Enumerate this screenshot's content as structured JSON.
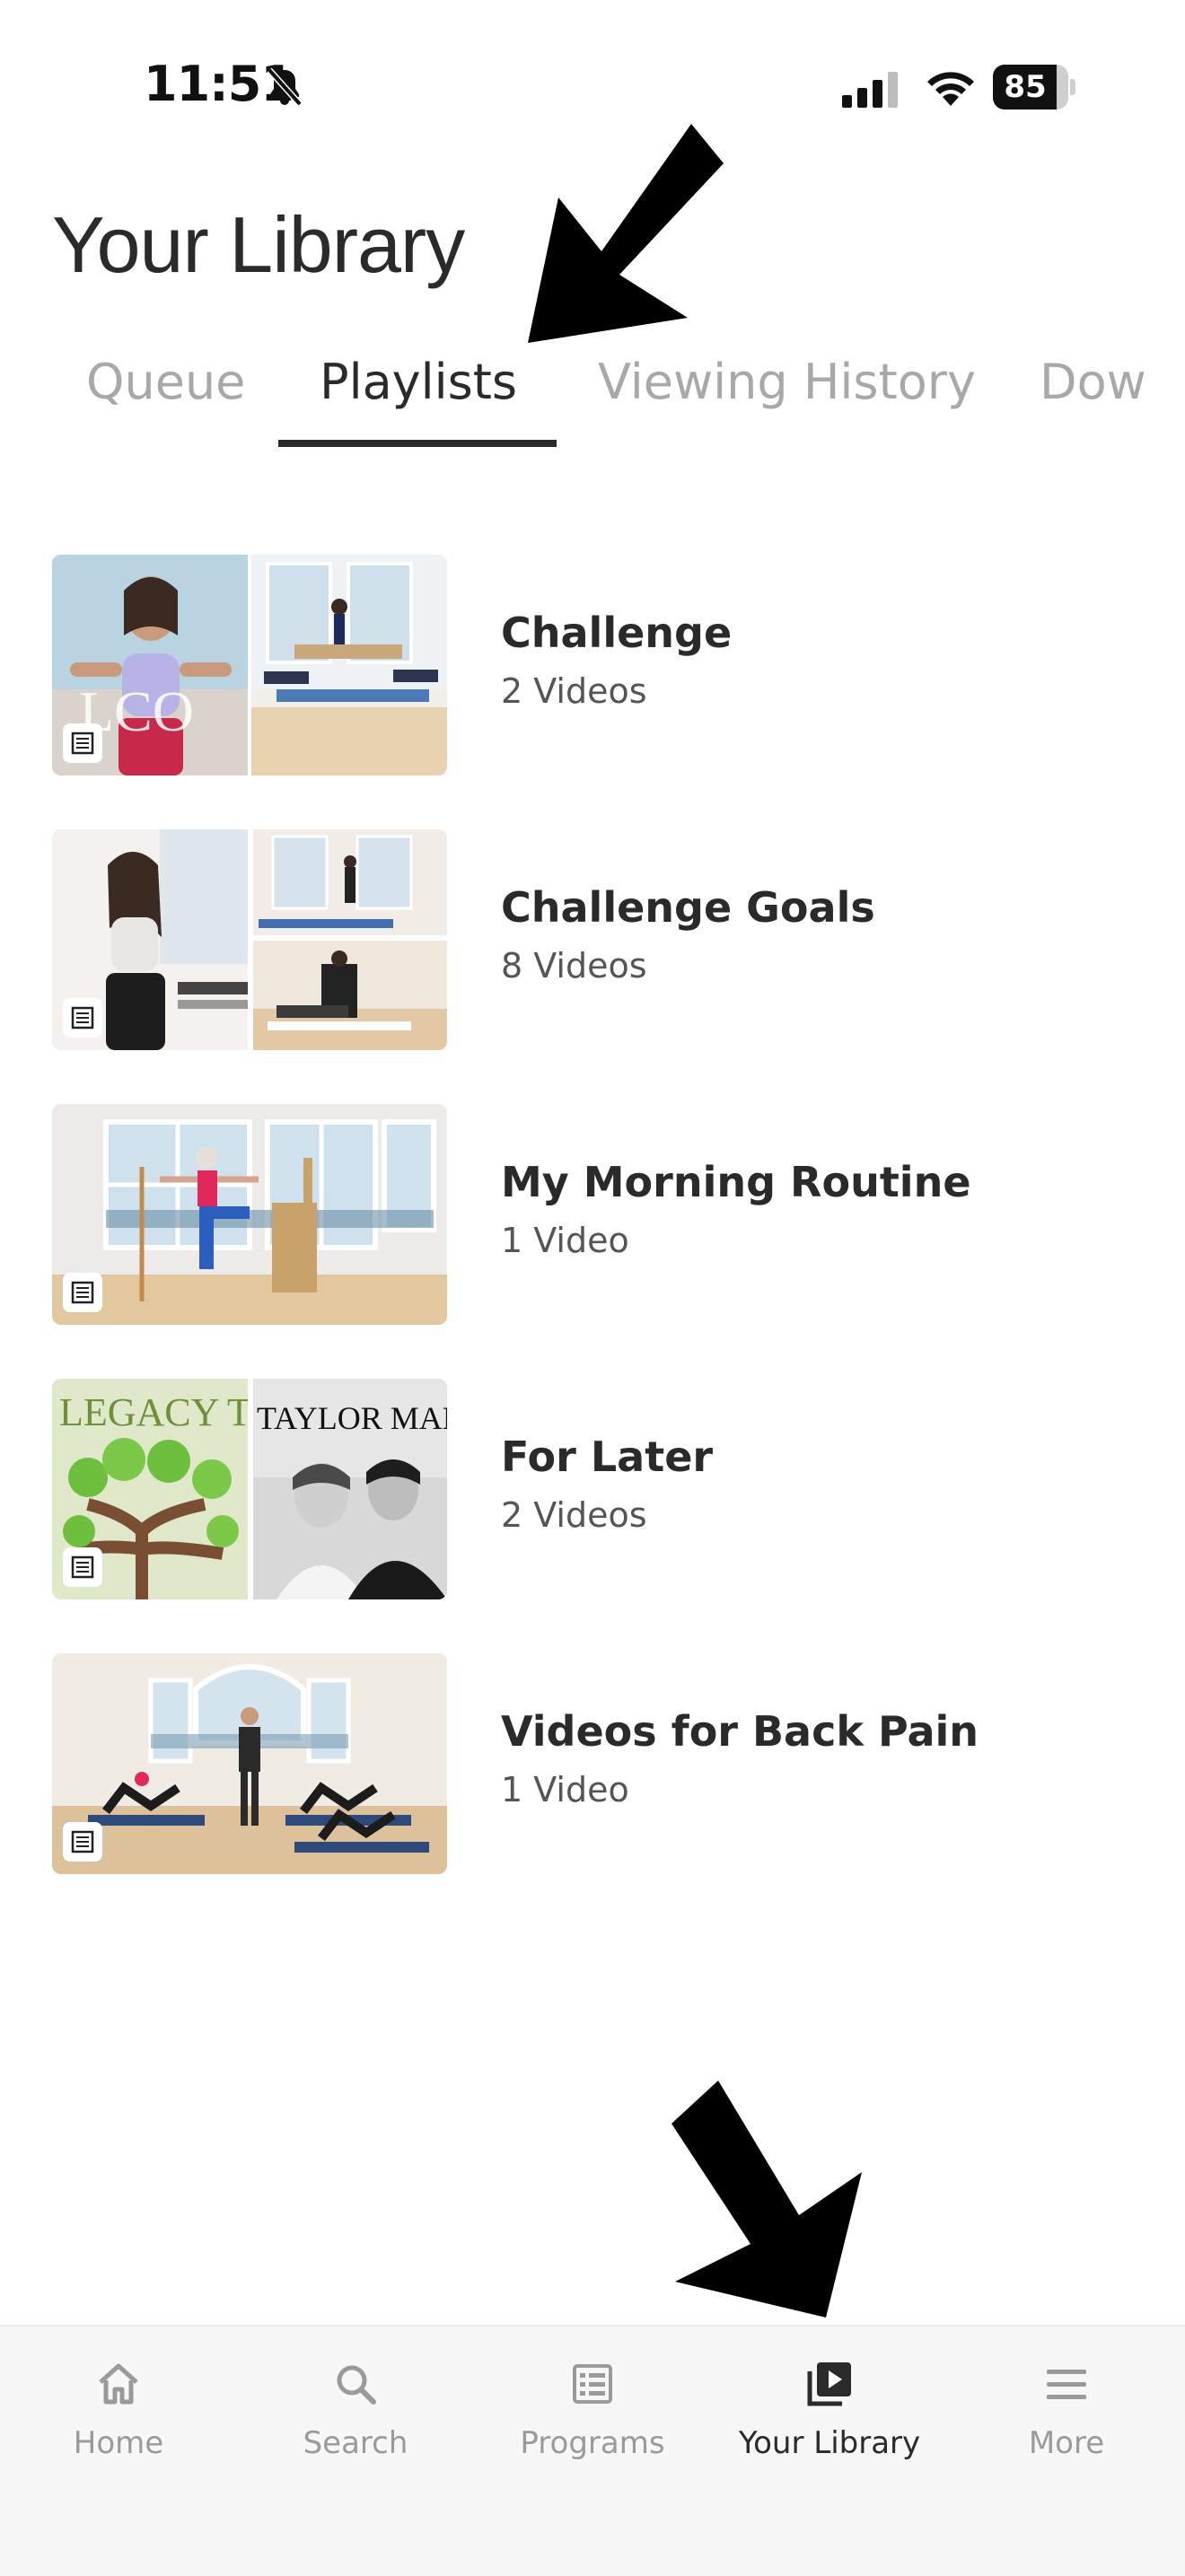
{
  "status_bar": {
    "time": "11:51",
    "battery": "85",
    "battery_level": 0.85
  },
  "header": {
    "title": "Your Library"
  },
  "tabs": [
    {
      "label": "Queue"
    },
    {
      "label": "Playlists"
    },
    {
      "label": "Viewing History"
    },
    {
      "label": "Dow"
    }
  ],
  "playlists": [
    {
      "title": "Challenge",
      "count": "2 Videos",
      "thumb_text": "LCO"
    },
    {
      "title": "Challenge Goals",
      "count": "8 Videos"
    },
    {
      "title": "My Morning Routine",
      "count": "1 Video"
    },
    {
      "title": "For Later",
      "count": "2 Videos",
      "thumb_text_left": "LEGACY T",
      "thumb_text_right": "TAYLOR MADE"
    },
    {
      "title": "Videos for Back Pain",
      "count": "1 Video"
    }
  ],
  "bottom_nav": [
    {
      "label": "Home",
      "icon": "home-icon"
    },
    {
      "label": "Search",
      "icon": "search-icon"
    },
    {
      "label": "Programs",
      "icon": "programs-icon"
    },
    {
      "label": "Your Library",
      "icon": "library-icon"
    },
    {
      "label": "More",
      "icon": "menu-icon"
    }
  ],
  "colors": {
    "active": "#2a2a2a",
    "inactive": "#a8a8a8",
    "nav_inactive": "#9a9a9a"
  }
}
